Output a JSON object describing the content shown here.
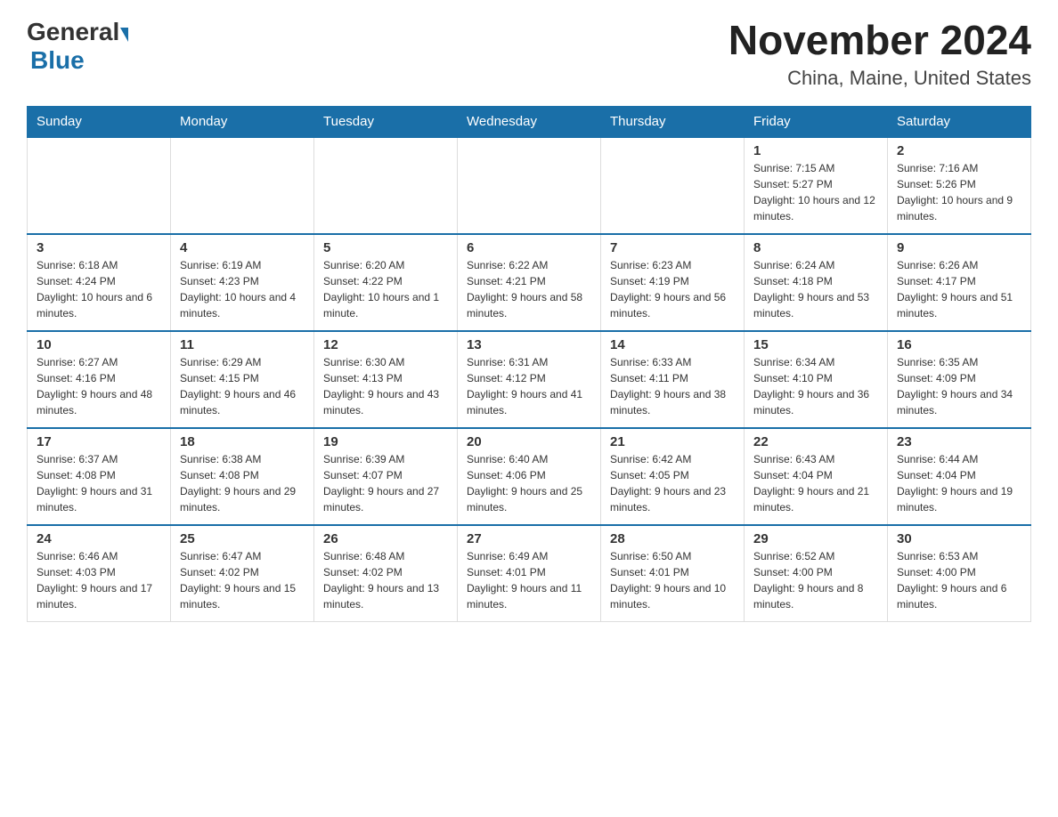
{
  "header": {
    "title": "November 2024",
    "subtitle": "China, Maine, United States",
    "logo_general": "General",
    "logo_blue": "Blue"
  },
  "weekdays": [
    "Sunday",
    "Monday",
    "Tuesday",
    "Wednesday",
    "Thursday",
    "Friday",
    "Saturday"
  ],
  "rows": [
    {
      "cells": [
        {
          "day": "",
          "empty": true
        },
        {
          "day": "",
          "empty": true
        },
        {
          "day": "",
          "empty": true
        },
        {
          "day": "",
          "empty": true
        },
        {
          "day": "",
          "empty": true
        },
        {
          "day": "1",
          "sunrise": "Sunrise: 7:15 AM",
          "sunset": "Sunset: 5:27 PM",
          "daylight": "Daylight: 10 hours and 12 minutes."
        },
        {
          "day": "2",
          "sunrise": "Sunrise: 7:16 AM",
          "sunset": "Sunset: 5:26 PM",
          "daylight": "Daylight: 10 hours and 9 minutes."
        }
      ]
    },
    {
      "cells": [
        {
          "day": "3",
          "sunrise": "Sunrise: 6:18 AM",
          "sunset": "Sunset: 4:24 PM",
          "daylight": "Daylight: 10 hours and 6 minutes."
        },
        {
          "day": "4",
          "sunrise": "Sunrise: 6:19 AM",
          "sunset": "Sunset: 4:23 PM",
          "daylight": "Daylight: 10 hours and 4 minutes."
        },
        {
          "day": "5",
          "sunrise": "Sunrise: 6:20 AM",
          "sunset": "Sunset: 4:22 PM",
          "daylight": "Daylight: 10 hours and 1 minute."
        },
        {
          "day": "6",
          "sunrise": "Sunrise: 6:22 AM",
          "sunset": "Sunset: 4:21 PM",
          "daylight": "Daylight: 9 hours and 58 minutes."
        },
        {
          "day": "7",
          "sunrise": "Sunrise: 6:23 AM",
          "sunset": "Sunset: 4:19 PM",
          "daylight": "Daylight: 9 hours and 56 minutes."
        },
        {
          "day": "8",
          "sunrise": "Sunrise: 6:24 AM",
          "sunset": "Sunset: 4:18 PM",
          "daylight": "Daylight: 9 hours and 53 minutes."
        },
        {
          "day": "9",
          "sunrise": "Sunrise: 6:26 AM",
          "sunset": "Sunset: 4:17 PM",
          "daylight": "Daylight: 9 hours and 51 minutes."
        }
      ]
    },
    {
      "cells": [
        {
          "day": "10",
          "sunrise": "Sunrise: 6:27 AM",
          "sunset": "Sunset: 4:16 PM",
          "daylight": "Daylight: 9 hours and 48 minutes."
        },
        {
          "day": "11",
          "sunrise": "Sunrise: 6:29 AM",
          "sunset": "Sunset: 4:15 PM",
          "daylight": "Daylight: 9 hours and 46 minutes."
        },
        {
          "day": "12",
          "sunrise": "Sunrise: 6:30 AM",
          "sunset": "Sunset: 4:13 PM",
          "daylight": "Daylight: 9 hours and 43 minutes."
        },
        {
          "day": "13",
          "sunrise": "Sunrise: 6:31 AM",
          "sunset": "Sunset: 4:12 PM",
          "daylight": "Daylight: 9 hours and 41 minutes."
        },
        {
          "day": "14",
          "sunrise": "Sunrise: 6:33 AM",
          "sunset": "Sunset: 4:11 PM",
          "daylight": "Daylight: 9 hours and 38 minutes."
        },
        {
          "day": "15",
          "sunrise": "Sunrise: 6:34 AM",
          "sunset": "Sunset: 4:10 PM",
          "daylight": "Daylight: 9 hours and 36 minutes."
        },
        {
          "day": "16",
          "sunrise": "Sunrise: 6:35 AM",
          "sunset": "Sunset: 4:09 PM",
          "daylight": "Daylight: 9 hours and 34 minutes."
        }
      ]
    },
    {
      "cells": [
        {
          "day": "17",
          "sunrise": "Sunrise: 6:37 AM",
          "sunset": "Sunset: 4:08 PM",
          "daylight": "Daylight: 9 hours and 31 minutes."
        },
        {
          "day": "18",
          "sunrise": "Sunrise: 6:38 AM",
          "sunset": "Sunset: 4:08 PM",
          "daylight": "Daylight: 9 hours and 29 minutes."
        },
        {
          "day": "19",
          "sunrise": "Sunrise: 6:39 AM",
          "sunset": "Sunset: 4:07 PM",
          "daylight": "Daylight: 9 hours and 27 minutes."
        },
        {
          "day": "20",
          "sunrise": "Sunrise: 6:40 AM",
          "sunset": "Sunset: 4:06 PM",
          "daylight": "Daylight: 9 hours and 25 minutes."
        },
        {
          "day": "21",
          "sunrise": "Sunrise: 6:42 AM",
          "sunset": "Sunset: 4:05 PM",
          "daylight": "Daylight: 9 hours and 23 minutes."
        },
        {
          "day": "22",
          "sunrise": "Sunrise: 6:43 AM",
          "sunset": "Sunset: 4:04 PM",
          "daylight": "Daylight: 9 hours and 21 minutes."
        },
        {
          "day": "23",
          "sunrise": "Sunrise: 6:44 AM",
          "sunset": "Sunset: 4:04 PM",
          "daylight": "Daylight: 9 hours and 19 minutes."
        }
      ]
    },
    {
      "cells": [
        {
          "day": "24",
          "sunrise": "Sunrise: 6:46 AM",
          "sunset": "Sunset: 4:03 PM",
          "daylight": "Daylight: 9 hours and 17 minutes."
        },
        {
          "day": "25",
          "sunrise": "Sunrise: 6:47 AM",
          "sunset": "Sunset: 4:02 PM",
          "daylight": "Daylight: 9 hours and 15 minutes."
        },
        {
          "day": "26",
          "sunrise": "Sunrise: 6:48 AM",
          "sunset": "Sunset: 4:02 PM",
          "daylight": "Daylight: 9 hours and 13 minutes."
        },
        {
          "day": "27",
          "sunrise": "Sunrise: 6:49 AM",
          "sunset": "Sunset: 4:01 PM",
          "daylight": "Daylight: 9 hours and 11 minutes."
        },
        {
          "day": "28",
          "sunrise": "Sunrise: 6:50 AM",
          "sunset": "Sunset: 4:01 PM",
          "daylight": "Daylight: 9 hours and 10 minutes."
        },
        {
          "day": "29",
          "sunrise": "Sunrise: 6:52 AM",
          "sunset": "Sunset: 4:00 PM",
          "daylight": "Daylight: 9 hours and 8 minutes."
        },
        {
          "day": "30",
          "sunrise": "Sunrise: 6:53 AM",
          "sunset": "Sunset: 4:00 PM",
          "daylight": "Daylight: 9 hours and 6 minutes."
        }
      ]
    }
  ]
}
